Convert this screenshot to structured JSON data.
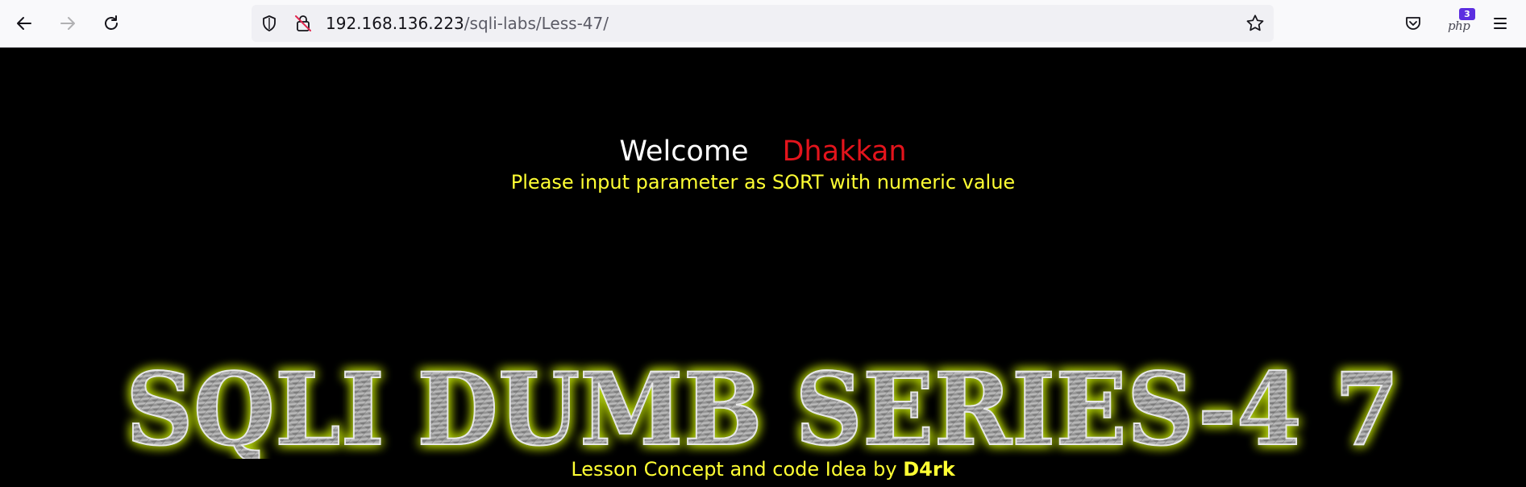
{
  "browser": {
    "url_host": "192.168.136.223",
    "url_path": "/sqli-labs/Less-47/",
    "extension_badge_count": "3",
    "extension_label": "php"
  },
  "page": {
    "welcome": "Welcome",
    "name": "Dhakkan",
    "instructions": "Please input parameter as SORT with numeric value",
    "banner_text": "SQLI DUMB SERIES-4 7",
    "lesson_prefix": "Lesson Concept and code Idea by ",
    "lesson_author": "D4rk"
  },
  "colors": {
    "background": "#000000",
    "welcome": "#ffffff",
    "name": "#e3141c",
    "instructions": "#ffff33",
    "banner_glow": "#b6d40c",
    "banner_metal": "#8d8d8d"
  },
  "icons": [
    "back-arrow-icon",
    "forward-arrow-icon",
    "reload-icon",
    "shield-icon",
    "insecure-lock-icon",
    "bookmark-star-icon",
    "pocket-icon",
    "php-extension-icon",
    "hamburger-menu-icon"
  ]
}
